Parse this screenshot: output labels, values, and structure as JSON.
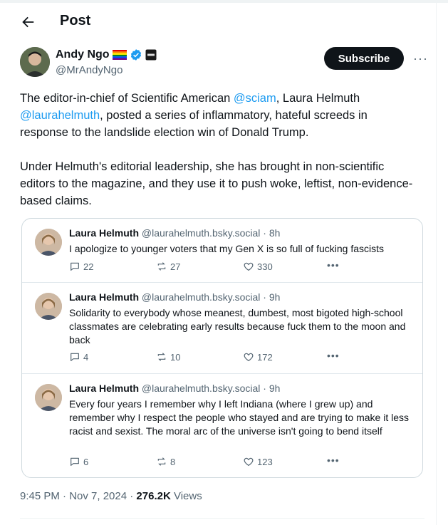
{
  "header": {
    "title": "Post"
  },
  "author": {
    "name": "Andy Ngo",
    "handle": "@MrAndyNgo",
    "subscribe_label": "Subscribe"
  },
  "tweet": {
    "para1": {
      "t1": "The editor-in-chief of Scientific American ",
      "m1": "@sciam",
      "t2": ", Laura Helmuth ",
      "m2": "@laurahelmuth",
      "t3": ", posted a series of inflammatory, hateful screeds in response to the landslide election win of Donald Trump."
    },
    "para2": "Under Helmuth's editorial leadership, she has brought in non-scientific editors to the magazine, and they use it to push woke, leftist, non-evidence-based claims."
  },
  "embedded_posts": [
    {
      "name": "Laura Helmuth",
      "handle": "@laurahelmuth.bsky.social",
      "time": "· 8h",
      "text": "I apologize to younger voters that my Gen X is so full of fucking fascists",
      "replies": "22",
      "reposts": "27",
      "likes": "330"
    },
    {
      "name": "Laura Helmuth",
      "handle": "@laurahelmuth.bsky.social",
      "time": "· 9h",
      "text": "Solidarity to everybody whose meanest, dumbest, most bigoted high-school classmates are celebrating early results because fuck them to the moon and back",
      "replies": "4",
      "reposts": "10",
      "likes": "172"
    },
    {
      "name": "Laura Helmuth",
      "handle": "@laurahelmuth.bsky.social",
      "time": "· 9h",
      "text": "Every four years I remember why I left Indiana (where I grew up) and remember why I respect the people who stayed and are trying to make it less racist and sexist. The moral arc of the universe isn't going to bend itself",
      "replies": "6",
      "reposts": "8",
      "likes": "123"
    }
  ],
  "footer": {
    "datetime": "9:45 PM · Nov 7, 2024 · ",
    "views_count": "276.2K",
    "views_label": " Views"
  },
  "icons": {
    "back": "arrow-left-icon",
    "verified": "verified-badge-icon",
    "flag": "rainbow-flag-icon",
    "affiliate": "affiliate-badge-icon",
    "more": "more-dots-icon",
    "reply": "reply-icon",
    "repost": "repost-icon",
    "like": "heart-icon"
  },
  "colors": {
    "link": "#1d9bf0",
    "verified": "#1d9bf0",
    "secondary": "#536471",
    "button": "#0f1419"
  }
}
